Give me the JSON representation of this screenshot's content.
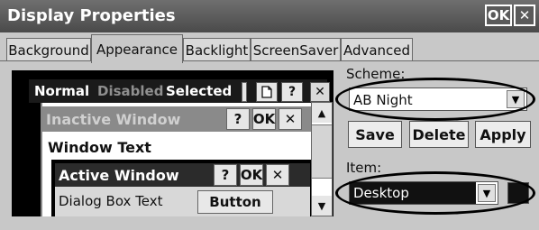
{
  "title": "Display Properties",
  "titlebar": {
    "ok_label": "OK",
    "close_label": "✕"
  },
  "tabs": [
    {
      "label": "Background"
    },
    {
      "label": "Appearance"
    },
    {
      "label": "Backlight"
    },
    {
      "label": "ScreenSaver"
    },
    {
      "label": "Advanced"
    }
  ],
  "preview": {
    "tab_normal": "Normal",
    "tab_disabled": "Disabled",
    "tab_selected": "Selected",
    "help_label": "?",
    "close_label": "✕",
    "inactive_title": "Inactive Window",
    "inactive_help": "?",
    "inactive_ok": "OK",
    "inactive_close": "✕",
    "window_text": "Window Text",
    "active_title": "Active Window",
    "active_help": "?",
    "active_ok": "OK",
    "active_close": "✕",
    "dialog_text": "Dialog Box Text",
    "button_label": "Button"
  },
  "scheme": {
    "label": "Scheme:",
    "value": "AB Night",
    "save": "Save",
    "delete": "Delete",
    "apply": "Apply"
  },
  "item": {
    "label": "Item:",
    "value": "Desktop"
  }
}
